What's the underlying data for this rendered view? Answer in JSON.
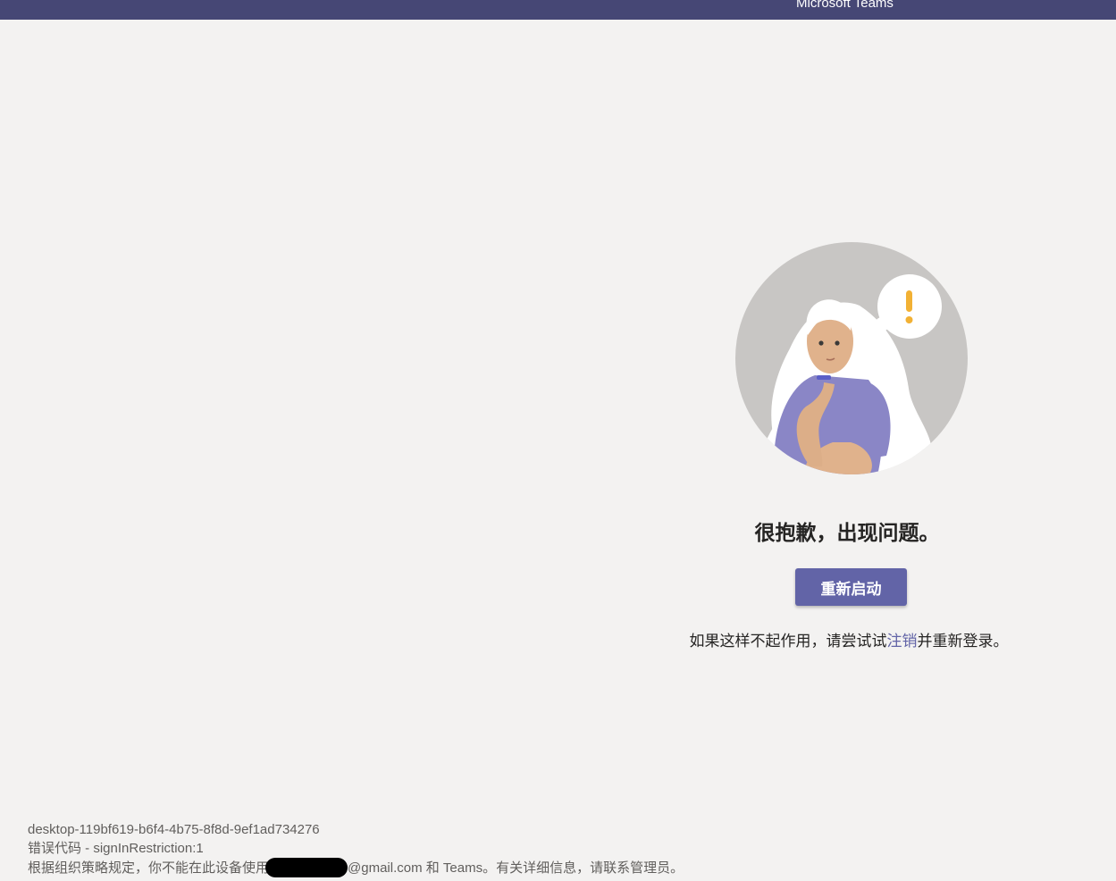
{
  "titlebar": {
    "title": "Microsoft Teams",
    "color": "#464775"
  },
  "error_page": {
    "illustration": "confused-person-with-exclamation-thought-bubble",
    "heading": "很抱歉，出现问题。",
    "restart_button_label": "重新启动",
    "hint_prefix": "如果这样不起作用，请尝试试",
    "hint_link": "注销",
    "hint_suffix": "并重新登录。",
    "accent_color": "#6264a7"
  },
  "diagnostics": {
    "session_id": "desktop-119bf619-b6f4-4b75-8f8d-9ef1ad734276",
    "error_code": "错误代码 - signInRestriction:1",
    "policy_prefix": "根据组织策略规定，你不能在此设备使用",
    "policy_suffix": "@gmail.com 和 Teams。有关详细信息，请联系管理员。"
  }
}
